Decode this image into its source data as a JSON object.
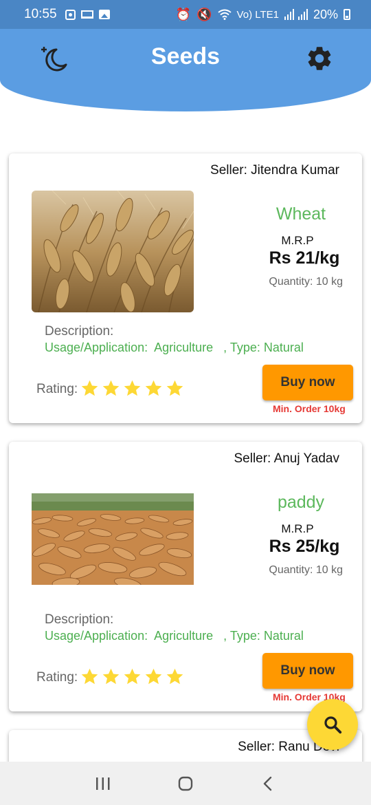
{
  "status_bar": {
    "time": "10:55",
    "network": "Vo) LTE1",
    "battery": "20%"
  },
  "header": {
    "title": "Seeds",
    "left_icon": "moon-icon",
    "right_icon": "gear-icon",
    "color": "#5b9de2"
  },
  "products": [
    {
      "seller": "Seller: Jitendra Kumar",
      "name": "Wheat",
      "mrp_label": "M.R.P",
      "price": "Rs 21/kg",
      "quantity": "Quantity: 10 kg",
      "description_label": "Description:",
      "usage": "Usage/Application:  Agriculture   , Type: Natural",
      "rating_label": "Rating:",
      "rating": 5,
      "buy_label": "Buy now",
      "min_order": "Min. Order 10kg"
    },
    {
      "seller": "Seller: Anuj Yadav",
      "name": "paddy",
      "mrp_label": "M.R.P",
      "price": "Rs 25/kg",
      "quantity": "Quantity: 10 kg",
      "description_label": "Description:",
      "usage": "Usage/Application:  Agriculture   , Type: Natural",
      "rating_label": "Rating:",
      "rating": 5,
      "buy_label": "Buy now",
      "min_order": "Min. Order 10kg"
    },
    {
      "seller": "Seller: Ranu Devi"
    }
  ],
  "fab": {
    "icon": "search-icon",
    "color": "#fdd835"
  },
  "nav": {
    "items": [
      "recent-apps-icon",
      "home-icon",
      "back-icon"
    ]
  },
  "colors": {
    "accent": "#ff9800",
    "green": "#5cb85c",
    "red": "#e53935",
    "star": "#fdd835"
  }
}
